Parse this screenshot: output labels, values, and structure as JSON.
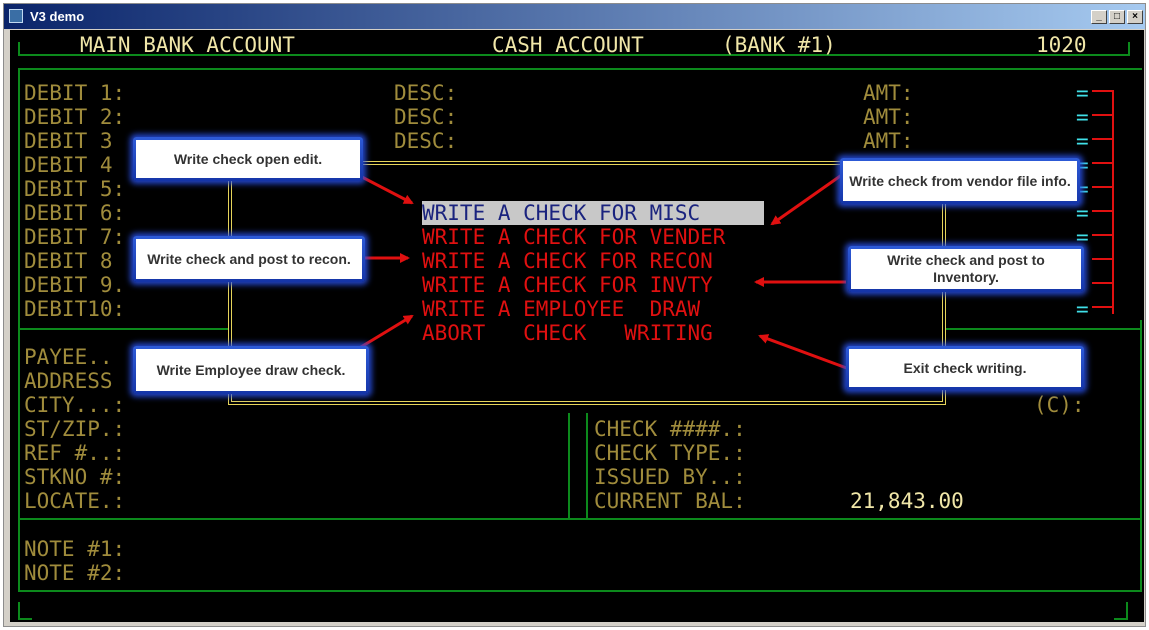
{
  "window": {
    "title": "V3 demo",
    "buttons": [
      "_",
      "□",
      "×"
    ]
  },
  "header": {
    "left": "MAIN BANK ACCOUNT",
    "middle": "CASH ACCOUNT",
    "bank": "(BANK #1)",
    "number": "1020"
  },
  "debits": [
    {
      "label": "DEBIT 1:",
      "desc": "DESC:",
      "amt": "AMT:"
    },
    {
      "label": "DEBIT 2:",
      "desc": "DESC:",
      "amt": "AMT:"
    },
    {
      "label": "DEBIT 3",
      "desc": "DESC:",
      "amt": "AMT:"
    },
    {
      "label": "DEBIT 4"
    },
    {
      "label": "DEBIT 5:"
    },
    {
      "label": "DEBIT 6:"
    },
    {
      "label": "DEBIT 7:"
    },
    {
      "label": "DEBIT 8"
    },
    {
      "label": "DEBIT 9."
    },
    {
      "label": "DEBIT10:"
    }
  ],
  "equals_glyph": "=",
  "menu": [
    {
      "label": "WRITE A CHECK FOR MISC",
      "selected": true
    },
    {
      "label": "WRITE A CHECK FOR VENDER"
    },
    {
      "label": "WRITE A CHECK FOR RECON"
    },
    {
      "label": "WRITE A CHECK FOR INVTY"
    },
    {
      "label": "WRITE A EMPLOYEE  DRAW"
    },
    {
      "label": "ABORT   CHECK   WRITING"
    }
  ],
  "payee_fields": [
    "PAYEE..",
    "ADDRESS",
    "CITY...:",
    "ST/ZIP.:",
    "REF #..:",
    "STKNO #:",
    "LOCATE.:"
  ],
  "check_fields": [
    "CHECK ####.:",
    "CHECK TYPE.:",
    "ISSUED BY..:",
    "CURRENT BAL:"
  ],
  "current_balance": "21,843.00",
  "c_marker": "(C):",
  "notes": [
    "NOTE #1:",
    "NOTE #2:"
  ],
  "callouts": {
    "open_edit": "Write check open edit.",
    "vendor": "Write check from vendor file info.",
    "recon": "Write check and post to recon.",
    "inventory": "Write check and post to Inventory.",
    "employee": "Write Employee draw check.",
    "exit": "Exit check writing."
  },
  "colors": {
    "label": "#a08c3c",
    "value": "#f0e6a8",
    "menu_red": "#e01010",
    "frame_green": "#0c8a1c",
    "popup_yellow": "#e6d45a",
    "callout_blue": "#2e5bd8"
  }
}
